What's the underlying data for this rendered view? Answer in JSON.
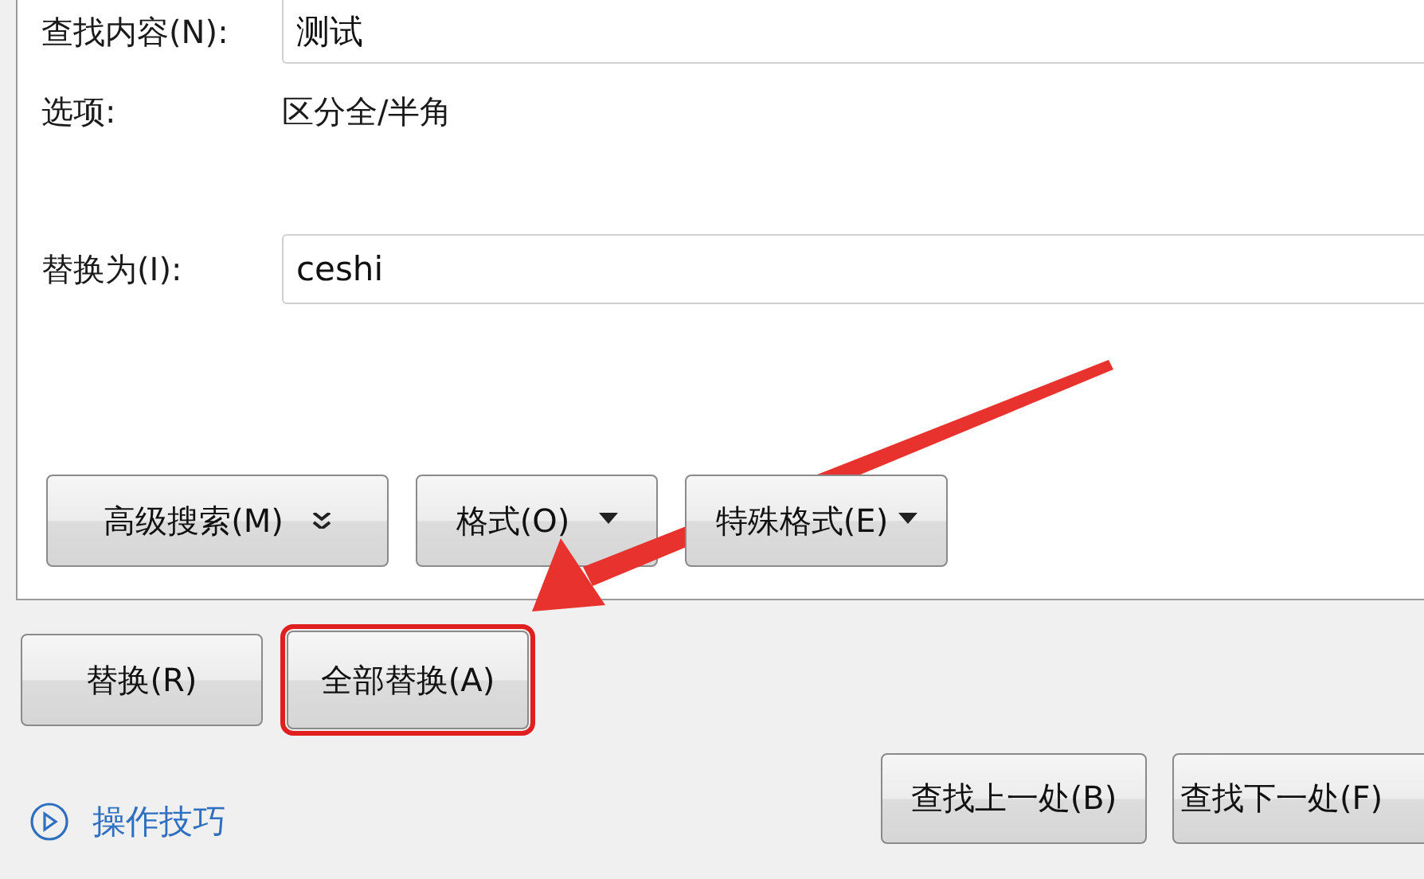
{
  "find": {
    "label": "查找内容(N):",
    "value": "测试"
  },
  "options": {
    "label": "选项:",
    "value": "区分全/半角"
  },
  "replace": {
    "label": "替换为(I):",
    "value": "ceshi"
  },
  "option_buttons": [
    {
      "label": "高级搜索(M)",
      "kind": "double-caret"
    },
    {
      "label": "格式(O)",
      "kind": "caret"
    },
    {
      "label": "特殊格式(E)",
      "kind": "caret"
    }
  ],
  "action_buttons": [
    {
      "label": "替换(R)",
      "highlighted": false
    },
    {
      "label": "全部替换(A)",
      "highlighted": true
    }
  ],
  "help_link": {
    "label": "操作技巧"
  },
  "nav_buttons": [
    {
      "label": "查找上一处(B)"
    },
    {
      "label": "查找下一处(F)"
    }
  ]
}
